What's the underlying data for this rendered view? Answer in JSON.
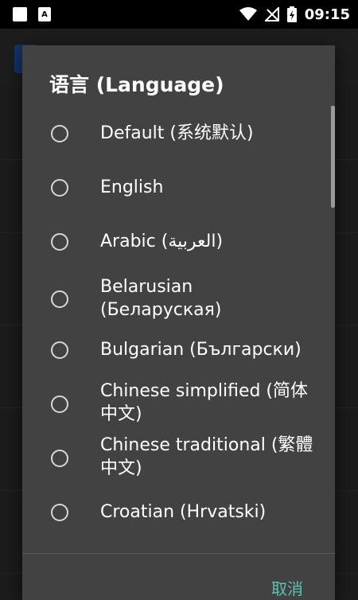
{
  "status_bar": {
    "time": "09:15",
    "notification_badge": "A",
    "icons": [
      "square-notification-icon",
      "a-notification-icon",
      "wifi-icon",
      "no-signal-icon",
      "battery-charging-icon"
    ]
  },
  "dialog": {
    "title": "语言 (Language)",
    "options": [
      {
        "label": "Default (系统默认)",
        "selected": false
      },
      {
        "label": "English",
        "selected": false
      },
      {
        "label": "Arabic (العربية)",
        "selected": false
      },
      {
        "label": "Belarusian (Беларуская)",
        "selected": false
      },
      {
        "label": "Bulgarian (Български)",
        "selected": false
      },
      {
        "label": "Chinese simplified (简体中文)",
        "selected": false
      },
      {
        "label": "Chinese traditional (繁體中文)",
        "selected": false
      },
      {
        "label": "Croatian (Hrvatski)",
        "selected": false
      }
    ],
    "cancel_label": "取消"
  },
  "colors": {
    "dialog_bg": "#424242",
    "accent": "#5fc2b3",
    "status_bar_bg": "#000000"
  }
}
